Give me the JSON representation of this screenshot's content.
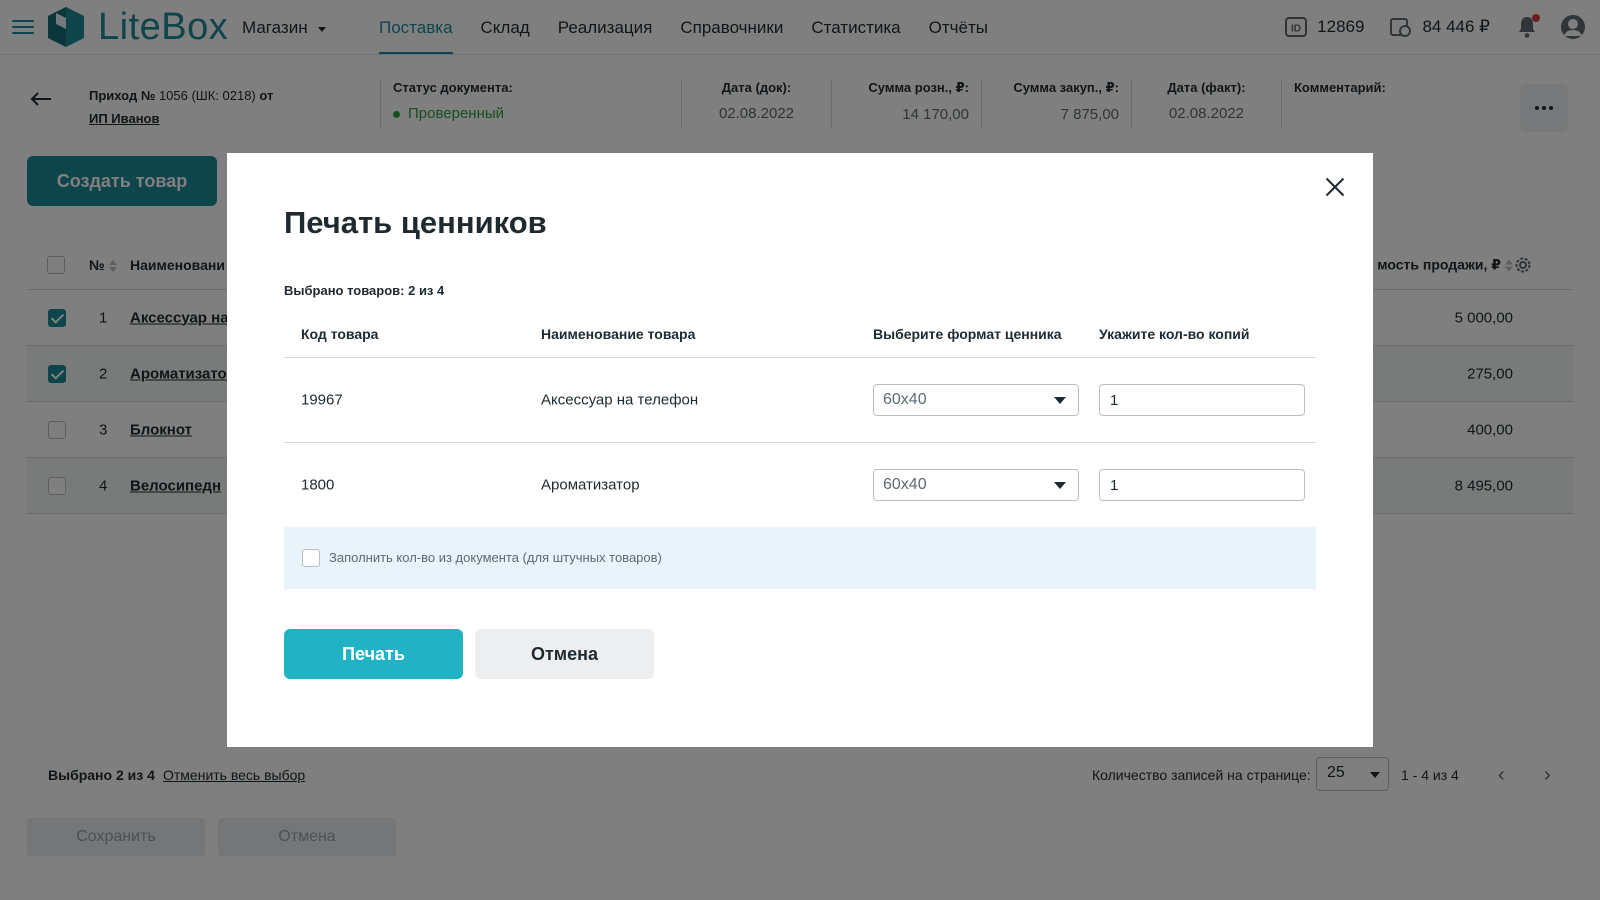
{
  "app": {
    "brand": "LiteBox",
    "store": "Магазин",
    "nav": [
      "Поставка",
      "Склад",
      "Реализация",
      "Справочники",
      "Статистика",
      "Отчёты"
    ],
    "active_nav_index": 0,
    "user_id": "12869",
    "balance": "84 446 ₽"
  },
  "document": {
    "title_prefix": "Приход №",
    "title_number": "1056 (ШК: 0218)",
    "title_suffix": "от",
    "supplier": "ИП Иванов",
    "status_label": "Статус документа:",
    "status_value": "Проверенный",
    "date_doc_label": "Дата (док):",
    "date_doc": "02.08.2022",
    "retail_label": "Сумма розн., ₽:",
    "retail_sum": "14 170,00",
    "purchase_label": "Сумма закуп., ₽:",
    "purchase_sum": "7 875,00",
    "date_fact_label": "Дата (факт):",
    "date_fact": "02.08.2022",
    "comment_label": "Комментарий:"
  },
  "actions": {
    "create_product": "Создать товар"
  },
  "table": {
    "col_num": "№",
    "col_name": "Наименовани",
    "col_sale": "мость продажи, ₽",
    "rows": [
      {
        "num": "1",
        "name": "Аксессуар на",
        "sale": "5 000,00",
        "checked": true
      },
      {
        "num": "2",
        "name": "Ароматизато",
        "sale": "275,00",
        "checked": true
      },
      {
        "num": "3",
        "name": "Блокнот",
        "sale": "400,00",
        "checked": false
      },
      {
        "num": "4",
        "name": "Велосипедн",
        "sale": "8 495,00",
        "checked": false
      }
    ]
  },
  "footer": {
    "selected": "Выбрано 2 из 4",
    "clear": "Отменить весь выбор",
    "per_page_label": "Количество записей на странице:",
    "per_page": "25",
    "range": "1 - 4 из 4",
    "save": "Сохранить",
    "cancel": "Отмена"
  },
  "modal": {
    "title": "Печать ценников",
    "selected_info": "Выбрано товаров: 2 из 4",
    "col_code": "Код товара",
    "col_name": "Наименование товара",
    "col_format": "Выберите формат ценника",
    "col_copies": "Укажите кол-во копий",
    "rows": [
      {
        "code": "19967",
        "name": "Аксессуар на телефон",
        "format": "60x40",
        "copies": "1"
      },
      {
        "code": "1800",
        "name": "Ароматизатор",
        "format": "60x40",
        "copies": "1"
      }
    ],
    "fill_label": "Заполнить кол-во из документа (для штучных товаров)",
    "print": "Печать",
    "cancel": "Отмена"
  },
  "colors": {
    "brand": "#1d8a96",
    "print_button": "#21b3c4",
    "status_ok": "#2f9e44"
  },
  "icons": [
    "menu-icon",
    "logo-icon",
    "id-icon",
    "wallet-icon",
    "bell-icon",
    "avatar-icon",
    "back-arrow-icon",
    "more-icon",
    "gear-icon",
    "close-icon"
  ]
}
